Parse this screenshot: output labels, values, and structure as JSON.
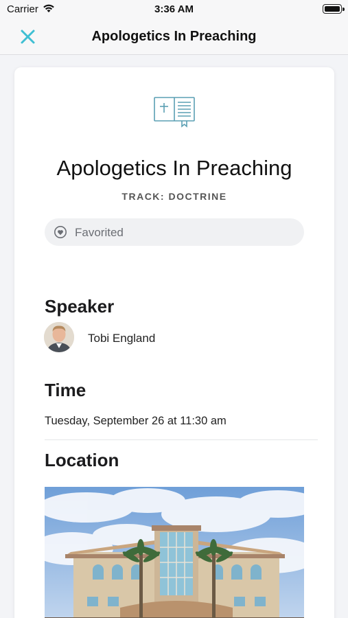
{
  "status_bar": {
    "carrier": "Carrier",
    "time": "3:36 AM"
  },
  "nav": {
    "title": "Apologetics In Preaching",
    "close_icon": "close-icon"
  },
  "session": {
    "icon": "book-icon",
    "title": "Apologetics In Preaching",
    "track": "TRACK: DOCTRINE",
    "favorite_label": "Favorited",
    "favorite_icon": "heart-icon"
  },
  "speaker": {
    "heading": "Speaker",
    "name": "Tobi England"
  },
  "time": {
    "heading": "Time",
    "value": "Tuesday, September 26 at 11:30 am"
  },
  "location": {
    "heading": "Location"
  },
  "colors": {
    "accent": "#3fbfd3",
    "icon_teal": "#5a9fb3",
    "background": "#f3f4f7",
    "card": "#ffffff"
  }
}
